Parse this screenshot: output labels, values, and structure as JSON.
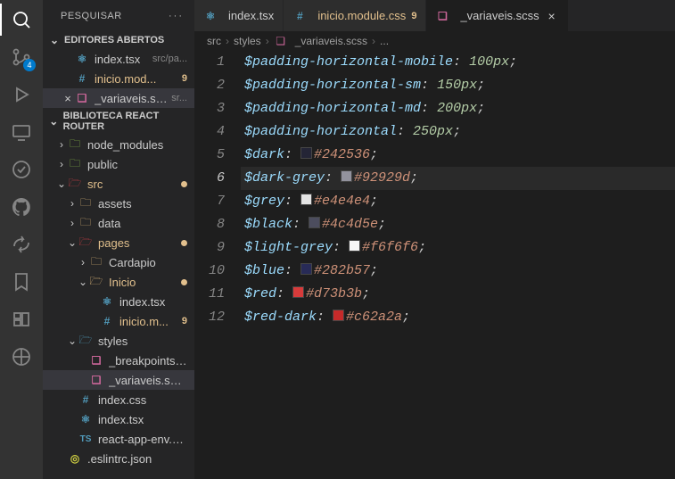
{
  "sidebar": {
    "title": "PESQUISAR",
    "sections": {
      "openEditors": "EDITORES ABERTOS",
      "project": "BIBLIOTECA REACT ROUTER"
    },
    "openEditors": [
      {
        "name": "index.tsx",
        "meta": "src/pa...",
        "icon": "react",
        "modified": false
      },
      {
        "name": "inicio.mod...",
        "meta": "",
        "icon": "css",
        "modified": true,
        "count": "9"
      },
      {
        "name": "_variaveis.scss",
        "meta": "sr...",
        "icon": "scss",
        "modified": false,
        "active": true
      }
    ],
    "tree": [
      {
        "depth": 0,
        "type": "folder",
        "name": "node_modules",
        "open": false,
        "color": "#8dc149"
      },
      {
        "depth": 0,
        "type": "folder",
        "name": "public",
        "open": false,
        "color": "#8dc149"
      },
      {
        "depth": 0,
        "type": "folder",
        "name": "src",
        "open": true,
        "color": "#cc3e44",
        "modified": true
      },
      {
        "depth": 1,
        "type": "folder",
        "name": "assets",
        "open": false,
        "color": "#dcb67a"
      },
      {
        "depth": 1,
        "type": "folder",
        "name": "data",
        "open": false,
        "color": "#dcb67a"
      },
      {
        "depth": 1,
        "type": "folder",
        "name": "pages",
        "open": true,
        "color": "#cc3e44",
        "modified": true
      },
      {
        "depth": 2,
        "type": "folder",
        "name": "Cardapio",
        "open": false,
        "color": "#dcb67a"
      },
      {
        "depth": 2,
        "type": "folder",
        "name": "Inicio",
        "open": true,
        "color": "#dcb67a",
        "modified": true
      },
      {
        "depth": 3,
        "type": "file",
        "name": "index.tsx",
        "icon": "react"
      },
      {
        "depth": 3,
        "type": "file",
        "name": "inicio.m...",
        "icon": "css",
        "modified": true,
        "count": "9"
      },
      {
        "depth": 1,
        "type": "folder",
        "name": "styles",
        "open": true,
        "color": "#519aba"
      },
      {
        "depth": 2,
        "type": "file",
        "name": "_breakpoints.s...",
        "icon": "scss"
      },
      {
        "depth": 2,
        "type": "file",
        "name": "_variaveis.scss",
        "icon": "scss",
        "selected": true
      },
      {
        "depth": 1,
        "type": "file",
        "name": "index.css",
        "icon": "css"
      },
      {
        "depth": 1,
        "type": "file",
        "name": "index.tsx",
        "icon": "react"
      },
      {
        "depth": 1,
        "type": "file",
        "name": "react-app-env.d...",
        "icon": "ts"
      },
      {
        "depth": 0,
        "type": "file",
        "name": ".eslintrc.json",
        "icon": "json"
      }
    ],
    "sourceBadge": "4"
  },
  "tabs": [
    {
      "label": "index.tsx",
      "icon": "react",
      "active": false
    },
    {
      "label": "inicio.module.css",
      "icon": "css",
      "active": false,
      "count": "9"
    },
    {
      "label": "_variaveis.scss",
      "icon": "scss",
      "active": true,
      "closable": true
    }
  ],
  "breadcrumb": {
    "parts": [
      "src",
      "styles",
      "_variaveis.scss"
    ],
    "tail": "..."
  },
  "code": {
    "lines": [
      {
        "n": 1,
        "var": "$padding-horizontal-mobile",
        "value": "100px",
        "kind": "num"
      },
      {
        "n": 2,
        "var": "$padding-horizontal-sm",
        "value": "150px",
        "kind": "num"
      },
      {
        "n": 3,
        "var": "$padding-horizontal-md",
        "value": "200px",
        "kind": "num"
      },
      {
        "n": 4,
        "var": "$padding-horizontal",
        "value": "250px",
        "kind": "num"
      },
      {
        "n": 5,
        "var": "$dark",
        "value": "#242536",
        "kind": "color"
      },
      {
        "n": 6,
        "var": "$dark-grey",
        "value": "#92929d",
        "kind": "color",
        "current": true
      },
      {
        "n": 7,
        "var": "$grey",
        "value": "#e4e4e4",
        "kind": "color"
      },
      {
        "n": 8,
        "var": "$black",
        "value": "#4c4d5e",
        "kind": "color"
      },
      {
        "n": 9,
        "var": "$light-grey",
        "value": "#f6f6f6",
        "kind": "color"
      },
      {
        "n": 10,
        "var": "$blue",
        "value": "#282b57",
        "kind": "color"
      },
      {
        "n": 11,
        "var": "$red",
        "value": "#d73b3b",
        "kind": "color"
      },
      {
        "n": 12,
        "var": "$red-dark",
        "value": "#c62a2a",
        "kind": "color"
      }
    ]
  }
}
